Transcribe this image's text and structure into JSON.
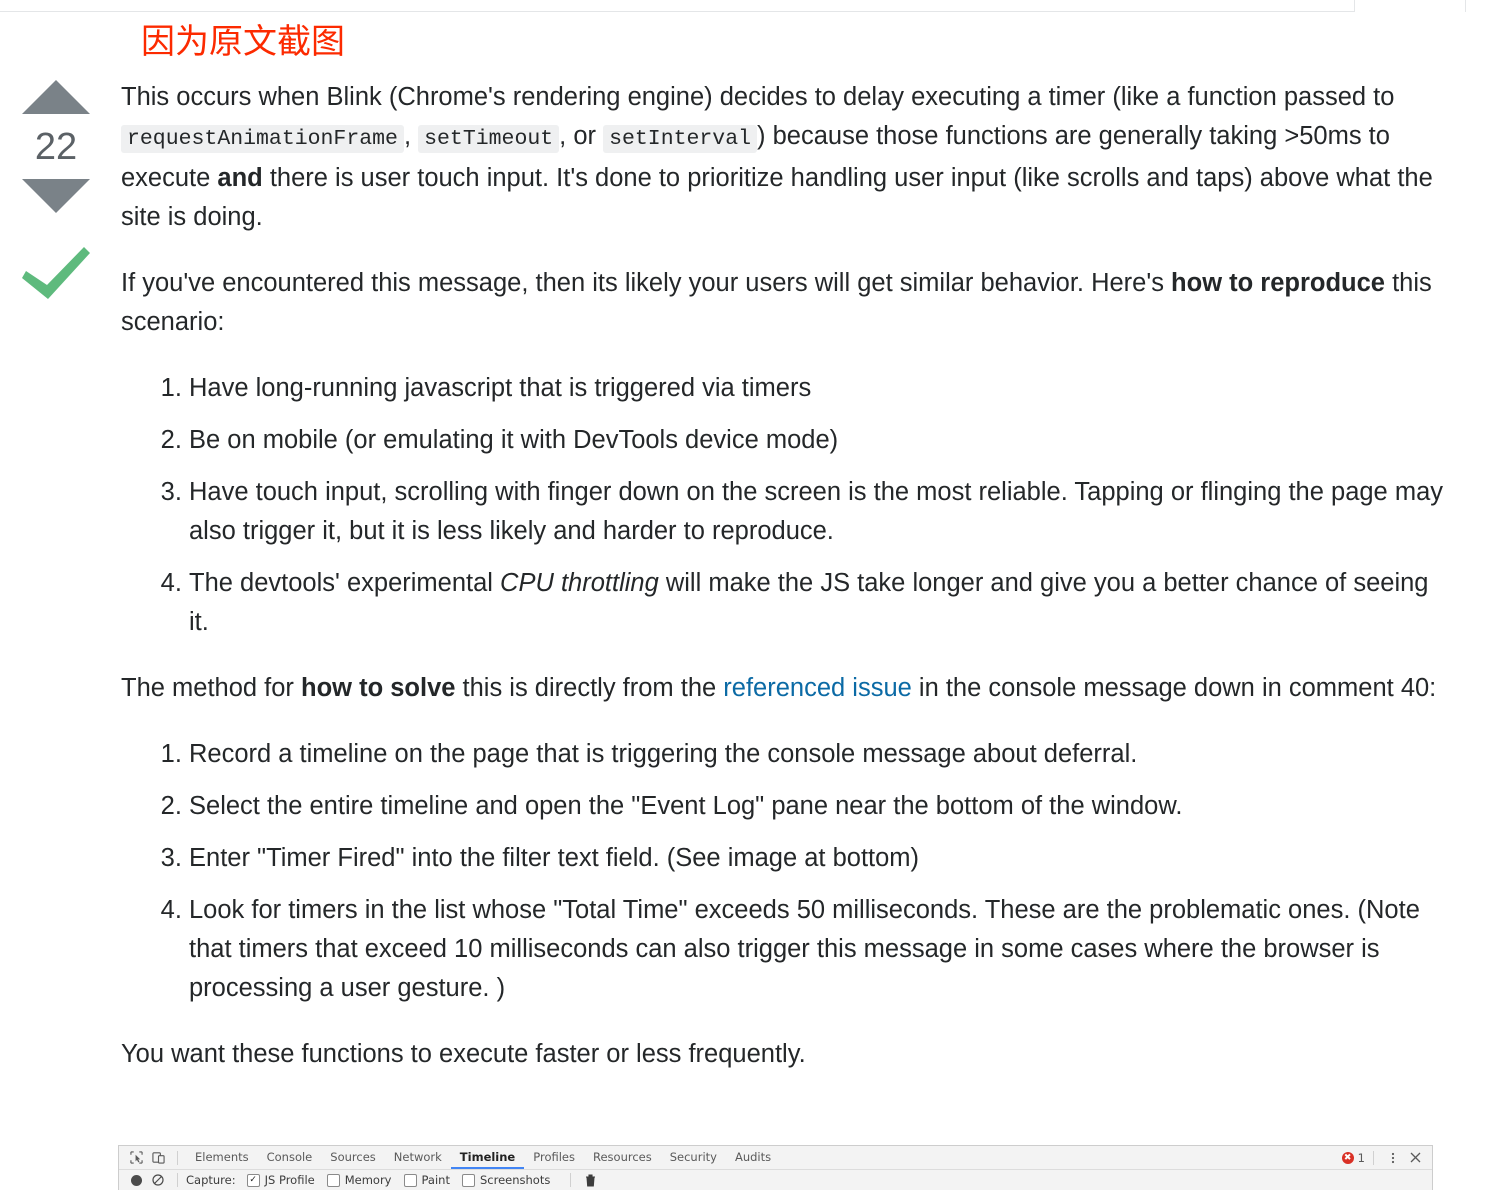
{
  "annotation": {
    "text": "因为原文截图",
    "color": "#fc2a00"
  },
  "vote": {
    "up_icon": "arrow-up-icon",
    "down_icon": "arrow-down-icon",
    "count": "22",
    "accepted_icon": "checkmark-icon",
    "arrow_color": "#7a8288",
    "accepted_color": "#5eba7d"
  },
  "post": {
    "p1": {
      "s1": "This occurs when Blink (Chrome's rendering engine) decides to delay executing a timer (like a function passed to ",
      "code1": "requestAnimationFrame",
      "s2": ", ",
      "code2": "setTimeout",
      "s3": ", or ",
      "code3": "setInterval",
      "s4": ") because those functions are generally taking >50ms to execute ",
      "bold1": "and",
      "s5": " there is user touch input. It's done to prioritize handling user input (like scrolls and taps) above what the site is doing."
    },
    "p2": {
      "s1": "If you've encountered this message, then its likely your users will get similar behavior. Here's ",
      "bold1": "how to reproduce",
      "s2": " this scenario:"
    },
    "list1": [
      {
        "text": "Have long-running javascript that is triggered via timers"
      },
      {
        "text": "Be on mobile (or emulating it with DevTools device mode)"
      },
      {
        "text": "Have touch input, scrolling with finger down on the screen is the most reliable. Tapping or flinging the page may also trigger it, but it is less likely and harder to reproduce."
      },
      {
        "pre": "The devtools' experimental ",
        "italic": "CPU throttling",
        "post": " will make the JS take longer and give you a better chance of seeing it."
      }
    ],
    "p3": {
      "s1": "The method for ",
      "bold1": "how to solve",
      "s2": " this is directly from the ",
      "link": "referenced issue",
      "s3": " in the console message down in comment 40:"
    },
    "list2": [
      "Record a timeline on the page that is triggering the console message about deferral.",
      "Select the entire timeline and open the \"Event Log\" pane near the bottom of the window.",
      "Enter \"Timer Fired\" into the filter text field. (See image at bottom)",
      "Look for timers in the list whose \"Total Time\" exceeds 50 milliseconds. These are the problematic ones. (Note that timers that exceed 10 milliseconds can also trigger this message in some cases where the browser is processing a user gesture. )"
    ],
    "p4": "You want these functions to execute faster or less frequently.",
    "link_color": "#0b6aa5"
  },
  "devtools": {
    "inspect_icon": "inspect-element-icon",
    "device_icon": "device-toolbar-icon",
    "tabs": [
      {
        "label": "Elements",
        "active": false
      },
      {
        "label": "Console",
        "active": false
      },
      {
        "label": "Sources",
        "active": false
      },
      {
        "label": "Network",
        "active": false
      },
      {
        "label": "Timeline",
        "active": true
      },
      {
        "label": "Profiles",
        "active": false
      },
      {
        "label": "Resources",
        "active": false
      },
      {
        "label": "Security",
        "active": false
      },
      {
        "label": "Audits",
        "active": false
      }
    ],
    "error_count": "1",
    "menu_icon": "kebab-menu-icon",
    "close_icon": "close-icon",
    "record_icon": "record-icon",
    "clear_icon": "clear-icon",
    "capture_label": "Capture:",
    "capture_options": [
      {
        "label": "JS Profile",
        "checked": true
      },
      {
        "label": "Memory",
        "checked": false
      },
      {
        "label": "Paint",
        "checked": false
      },
      {
        "label": "Screenshots",
        "checked": false
      }
    ],
    "trash_icon": "trash-icon",
    "active_tab_color": "#4285f4"
  }
}
